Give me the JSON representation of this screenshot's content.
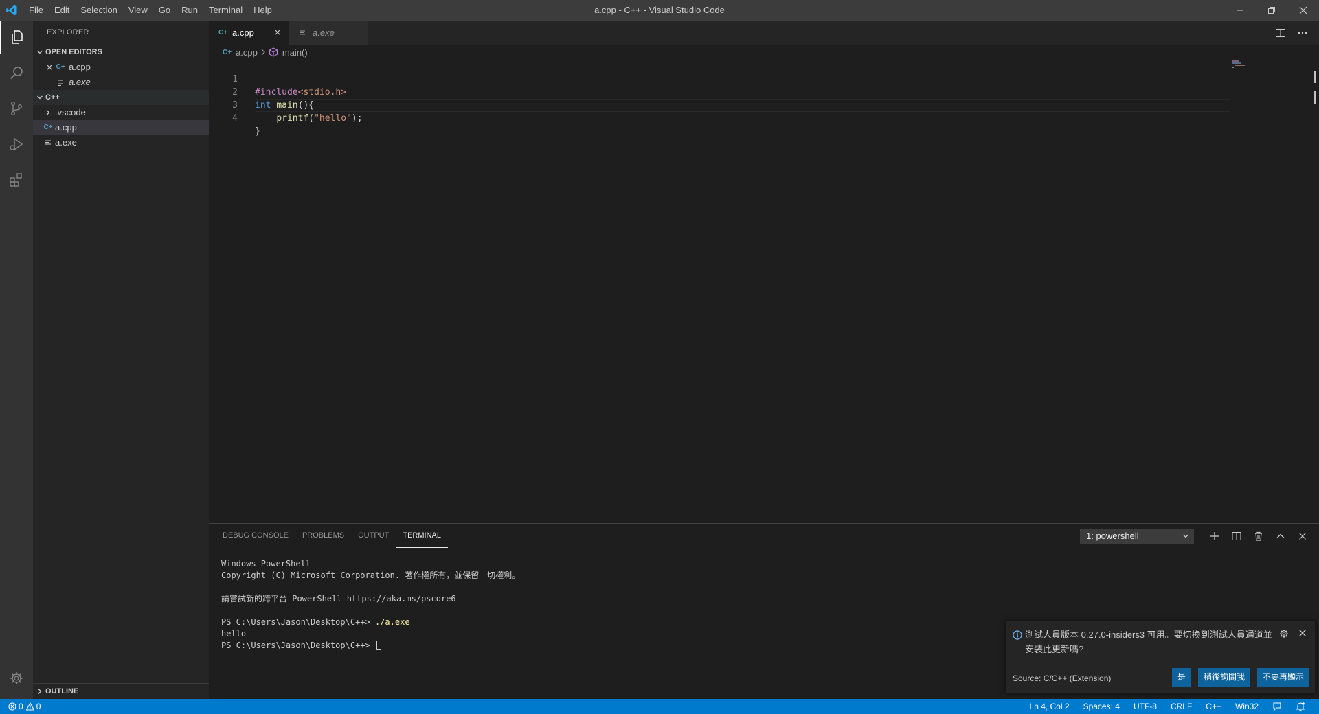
{
  "window": {
    "title": "a.cpp - C++ - Visual Studio Code"
  },
  "menu": [
    "File",
    "Edit",
    "Selection",
    "View",
    "Go",
    "Run",
    "Terminal",
    "Help"
  ],
  "colors": {
    "accent": "#007acc",
    "titlebar": "#3c3c3c",
    "sidebar": "#252526",
    "editor": "#1e1e1e",
    "button": "#0e639c"
  },
  "sidebar": {
    "title": "EXPLORER",
    "open_editors": {
      "header": "OPEN EDITORS",
      "items": [
        {
          "label": "a.cpp",
          "icon": "cpp-file-icon"
        },
        {
          "label": "a.exe",
          "icon": "binary-file-icon"
        }
      ]
    },
    "folder": {
      "header": "C++",
      "items": [
        {
          "label": ".vscode",
          "icon": "chevron-right-icon"
        },
        {
          "label": "a.cpp",
          "icon": "cpp-file-icon"
        },
        {
          "label": "a.exe",
          "icon": "binary-file-icon"
        }
      ]
    },
    "outline_header": "OUTLINE"
  },
  "tabs": [
    {
      "label": "a.cpp"
    },
    {
      "label": "a.exe"
    }
  ],
  "breadcrumb": {
    "file": "a.cpp",
    "symbol": "main()"
  },
  "code": {
    "line_numbers": [
      "1",
      "2",
      "3",
      "4"
    ],
    "line1": {
      "directive": "#include",
      "header": "<stdio.h>"
    },
    "line2": {
      "keyword": "int",
      "fn": "main",
      "rest": "(){"
    },
    "line3": {
      "indent": "    ",
      "fn": "printf",
      "open": "(",
      "str": "\"hello\"",
      "close": ");"
    },
    "line4": {
      "text": "}"
    }
  },
  "panel": {
    "tabs": [
      "DEBUG CONSOLE",
      "PROBLEMS",
      "OUTPUT",
      "TERMINAL"
    ],
    "active_tab": "TERMINAL",
    "terminal_select": "1: powershell",
    "terminal": {
      "line1": "Windows PowerShell",
      "line2": "Copyright (C) Microsoft Corporation. 著作權所有，並保留一切權利。",
      "line3": "請嘗試新的跨平台 PowerShell https://aka.ms/pscore6",
      "prompt": "PS C:\\Users\\Jason\\Desktop\\C++> ",
      "command": "./a.exe",
      "output": "hello"
    }
  },
  "notification": {
    "message": "測試人員版本 0.27.0-insiders3 可用。要切換到測試人員通道並安裝此更新嗎?",
    "source": "Source: C/C++ (Extension)",
    "buttons": [
      "是",
      "稍後詢問我",
      "不要再顯示"
    ]
  },
  "statusbar": {
    "errors": "0",
    "warnings": "0",
    "position": "Ln 4, Col 2",
    "spaces": "Spaces: 4",
    "encoding": "UTF-8",
    "eol": "CRLF",
    "language": "C++",
    "platform": "Win32"
  }
}
